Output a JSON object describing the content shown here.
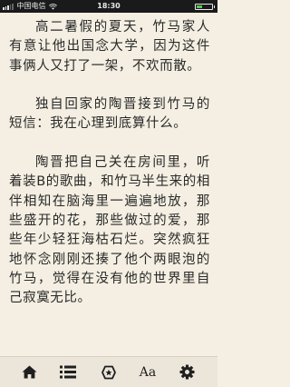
{
  "status_bar": {
    "carrier": "中国电信",
    "time": "18:30",
    "battery_level": 0.35,
    "battery_color": "#5ac85a",
    "signal_bars": 3,
    "icons": [
      "signal-icon",
      "wifi-icon",
      "battery-icon"
    ]
  },
  "reader": {
    "background_color": "#f4efe2",
    "text_color": "#2a2a2a",
    "paragraphs": [
      "高二暑假的夏天，竹马家人有意让他出国念大学，因为这件事俩人又打了一架，不欢而散。",
      "独自回家的陶晋接到竹马的短信：我在心理到底算什么。",
      "陶晋把自己关在房间里，听着装B的歌曲，和竹马半生来的相伴相知在脑海里一遍遍地放，那些盛开的花，那些做过的爱，那些年少轻狂海枯石烂。突然疯狂地怀念刚刚还揍了他个两眼泡的竹马，觉得在没有他的世界里自己寂寞无比。"
    ]
  },
  "toolbar": {
    "items": [
      {
        "icon": "home-icon"
      },
      {
        "icon": "list-icon"
      },
      {
        "icon": "bookmark-icon"
      },
      {
        "icon": "font-size-icon",
        "label": "Aa"
      },
      {
        "icon": "gear-icon"
      }
    ]
  }
}
